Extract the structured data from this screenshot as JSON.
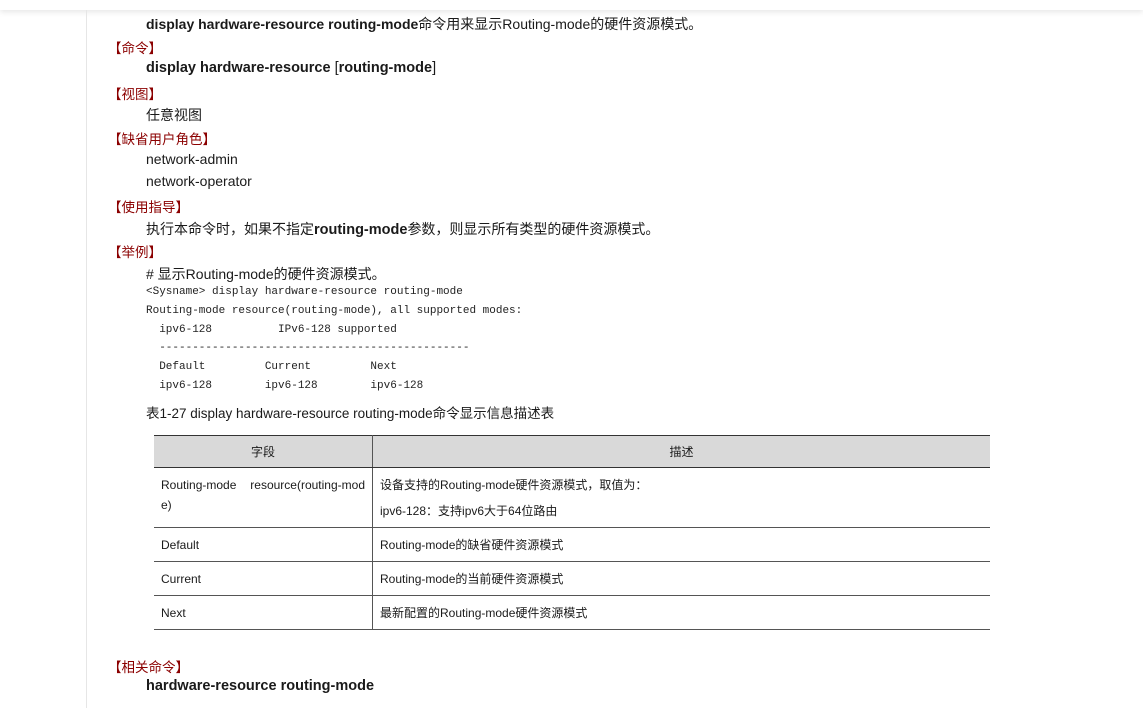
{
  "intro": {
    "command": "display hardware-resource routing-mode",
    "text": "命令用来显示Routing-mode的硬件资源模式。"
  },
  "sections": {
    "command": {
      "heading": "【命令】",
      "syntax_bold_1": "display hardware-resource",
      "syntax_bracket_open": " [",
      "syntax_bold_2": "routing-mode",
      "syntax_bracket_close": "]"
    },
    "view": {
      "heading": "【视图】",
      "value": "任意视图"
    },
    "roles": {
      "heading": "【缺省用户角色】",
      "items": [
        "network-admin",
        "network-operator"
      ]
    },
    "usage": {
      "heading": "【使用指导】",
      "prefix": "执行本命令时，如果不指定",
      "keyword": "routing-mode",
      "suffix": "参数，则显示所有类型的硬件资源模式。"
    },
    "example": {
      "heading": "【举例】",
      "comment": "# 显示Routing-mode的硬件资源模式。",
      "code": [
        "<Sysname> display hardware-resource routing-mode",
        "Routing-mode resource(routing-mode), all supported modes:",
        "  ipv6-128          IPv6-128 supported",
        "  -----------------------------------------------",
        "  Default         Current         Next",
        "  ipv6-128        ipv6-128        ipv6-128"
      ]
    },
    "table": {
      "caption": "表1-27 display hardware-resource routing-mode命令显示信息描述表",
      "headers": [
        "字段",
        "描述"
      ],
      "rows": [
        {
          "field": "Routing-mode resource(routing-mode)",
          "desc": "设备支持的Routing-mode硬件资源模式，取值为：",
          "desc2": "ipv6-128：支持ipv6大于64位路由"
        },
        {
          "field": "Default",
          "desc": "Routing-mode的缺省硬件资源模式"
        },
        {
          "field": "Current",
          "desc": "Routing-mode的当前硬件资源模式"
        },
        {
          "field": "Next",
          "desc": "最新配置的Routing-mode硬件资源模式"
        }
      ]
    },
    "related": {
      "heading": "【相关命令】",
      "command": "hardware-resource routing-mode"
    }
  }
}
